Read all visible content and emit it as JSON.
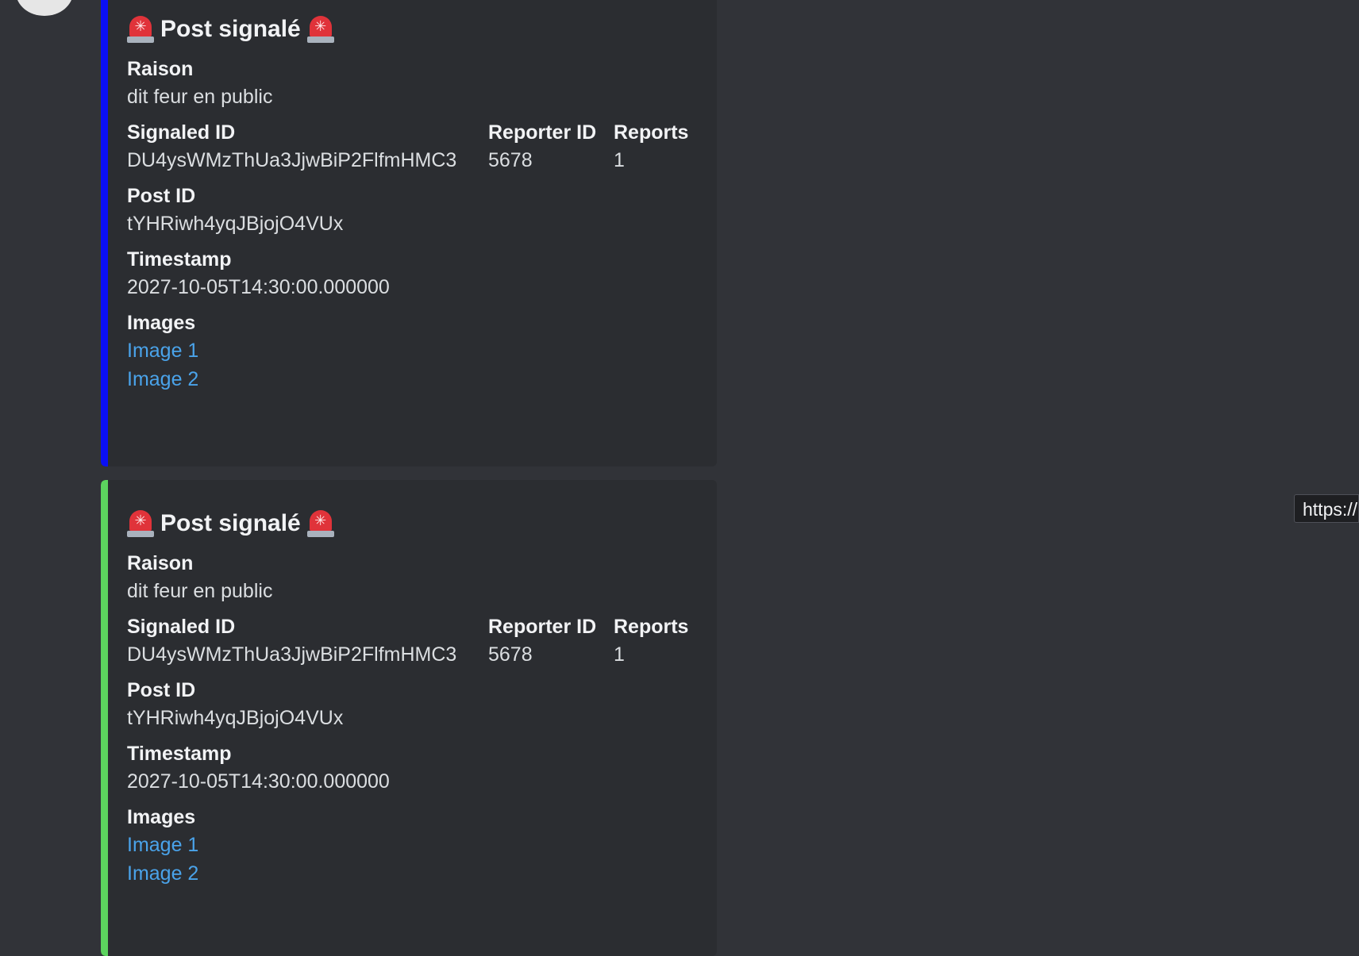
{
  "colors": {
    "background": "#313338",
    "embed_background": "#2b2d31",
    "embed1_accent": "#0a0ff5",
    "embed2_accent": "#5cd35e",
    "link": "#4aa3ea"
  },
  "embeds": [
    {
      "title": "Post signalé",
      "title_icon": "rotating-light-icon",
      "raison_label": "Raison",
      "raison_value": "dit feur en public",
      "signaled_id_label": "Signaled ID",
      "signaled_id_value": "DU4ysWMzThUa3JjwBiP2FlfmHMC3",
      "reporter_id_label": "Reporter ID",
      "reporter_id_value": "5678",
      "reports_label": "Reports",
      "reports_value": "1",
      "post_id_label": "Post ID",
      "post_id_value": "tYHRiwh4yqJBjojO4VUx",
      "timestamp_label": "Timestamp",
      "timestamp_value": "2027-10-05T14:30:00.000000",
      "images_label": "Images",
      "images": [
        "Image 1",
        "Image 2"
      ]
    },
    {
      "title": "Post signalé",
      "title_icon": "rotating-light-icon",
      "raison_label": "Raison",
      "raison_value": "dit feur en public",
      "signaled_id_label": "Signaled ID",
      "signaled_id_value": "DU4ysWMzThUa3JjwBiP2FlfmHMC3",
      "reporter_id_label": "Reporter ID",
      "reporter_id_value": "5678",
      "reports_label": "Reports",
      "reports_value": "1",
      "post_id_label": "Post ID",
      "post_id_value": "tYHRiwh4yqJBjojO4VUx",
      "timestamp_label": "Timestamp",
      "timestamp_value": "2027-10-05T14:30:00.000000",
      "images_label": "Images",
      "images": [
        "Image 1",
        "Image 2"
      ]
    }
  ],
  "tooltip": {
    "text": "https://"
  }
}
